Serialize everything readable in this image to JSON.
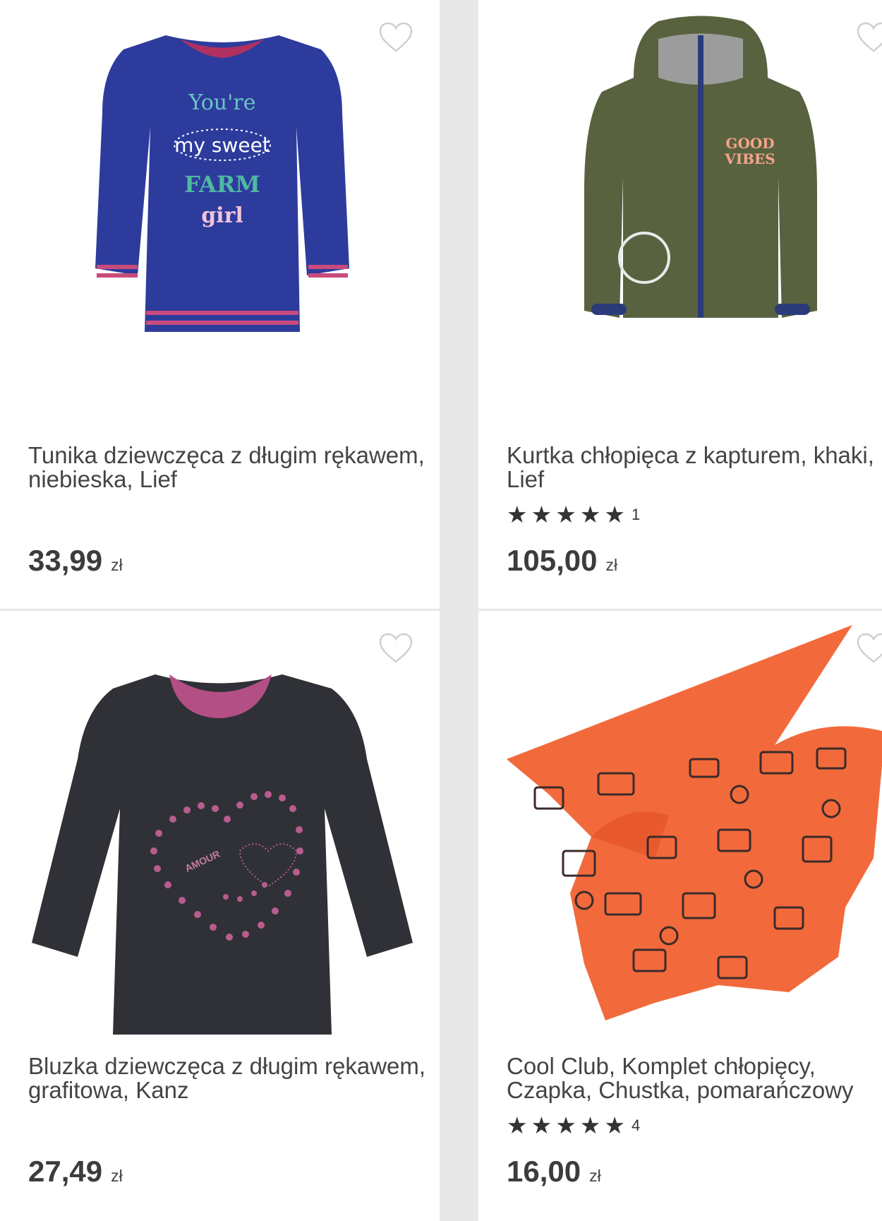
{
  "colors": {
    "background": "#e8e8e8",
    "card": "#ffffff",
    "text": "#3c3c3c",
    "heart": "#d0d0d0"
  },
  "products": [
    {
      "title": "Tunika dziewczęca z długim rękawem, niebieska, Lief",
      "price": "33,99",
      "currency": "zł",
      "shirt_text": [
        "You're",
        "my sweet",
        "FARM",
        "girl"
      ],
      "favorite_icon": "heart-outline-icon"
    },
    {
      "title": "Kurtka chłopięca z kapturem, khaki, Lief",
      "rating": 5,
      "rating_count": "1",
      "price": "105,00",
      "currency": "zł",
      "jacket_text": [
        "GOOD",
        "VIBES"
      ],
      "favorite_icon": "heart-outline-icon"
    },
    {
      "title": "Bluzka dziewczęca z długim rękawem, grafitowa, Kanz",
      "price": "27,49",
      "currency": "zł",
      "shirt_text": [
        "AMOUR"
      ],
      "favorite_icon": "heart-outline-icon"
    },
    {
      "title": "Cool Club, Komplet chłopięcy, Czapka, Chustka, pomarańczowy",
      "rating": 5,
      "rating_count": "4",
      "price": "16,00",
      "currency": "zł",
      "favorite_icon": "heart-outline-icon"
    }
  ]
}
